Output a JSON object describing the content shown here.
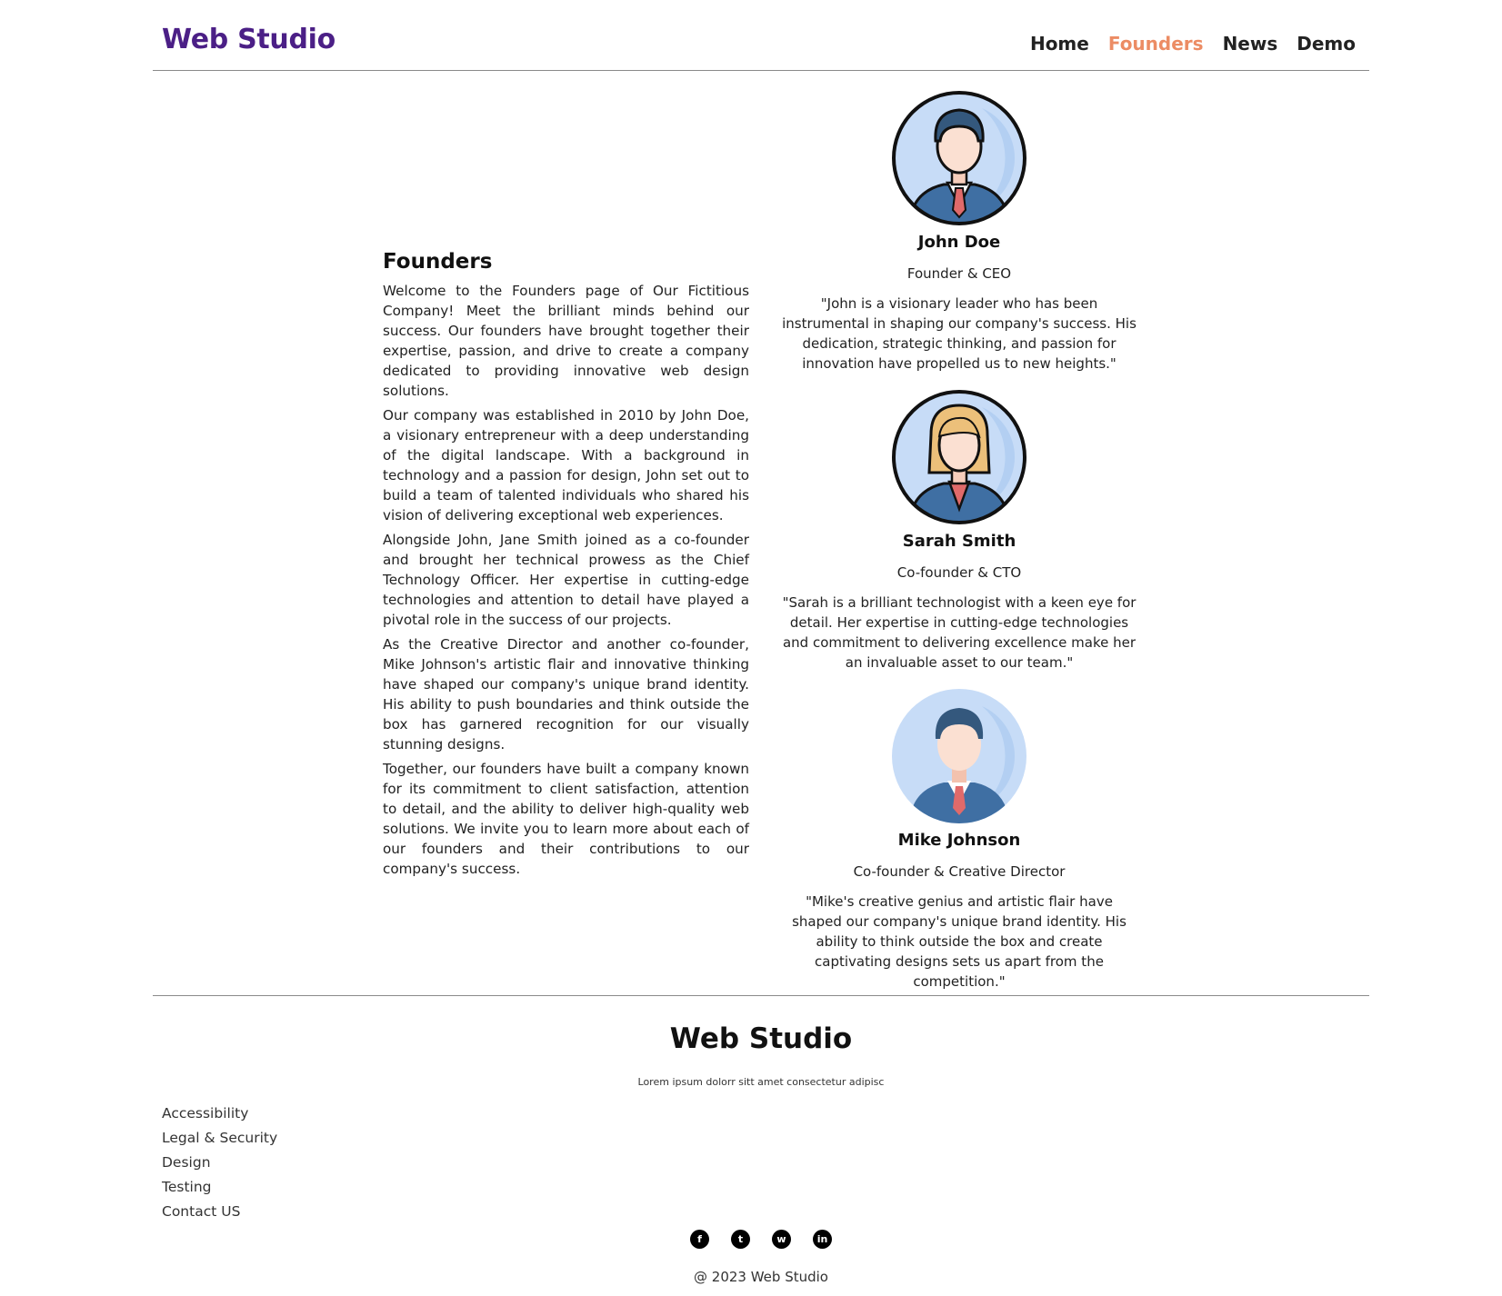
{
  "header": {
    "brand": "Web Studio",
    "nav": [
      {
        "label": "Home",
        "active": false
      },
      {
        "label": "Founders",
        "active": true
      },
      {
        "label": "News",
        "active": false
      },
      {
        "label": "Demo",
        "active": false
      }
    ]
  },
  "intro": {
    "title": "Founders",
    "paragraphs": [
      "Welcome to the Founders page of Our Fictitious Company! Meet the brilliant minds behind our success. Our founders have brought together their expertise, passion, and drive to create a company dedicated to providing innovative web design solutions.",
      "Our company was established in 2010 by John Doe, a visionary entrepreneur with a deep understanding of the digital landscape. With a background in technology and a passion for design, John set out to build a team of talented individuals who shared his vision of delivering exceptional web experiences.",
      "Alongside John, Jane Smith joined as a co-founder and brought her technical prowess as the Chief Technology Officer. Her expertise in cutting-edge technologies and attention to detail have played a pivotal role in the success of our projects.",
      "As the Creative Director and another co-founder, Mike Johnson's artistic flair and innovative thinking have shaped our company's unique brand identity. His ability to push boundaries and think outside the box has garnered recognition for our visually stunning designs.",
      "Together, our founders have built a company known for its commitment to client satisfaction, attention to detail, and the ability to deliver high-quality web solutions. We invite you to learn more about each of our founders and their contributions to our company's success."
    ]
  },
  "founders": [
    {
      "name": "John Doe",
      "role": "Founder & CEO",
      "quote": "\"John is a visionary leader who has been instrumental in shaping our company's success. His dedication, strategic thinking, and passion for innovation have propelled us to new heights.\"",
      "avatar": "businessman-avatar-icon"
    },
    {
      "name": "Sarah Smith",
      "role": "Co-founder & CTO",
      "quote": "\"Sarah is a brilliant technologist with a keen eye for detail. Her expertise in cutting-edge technologies and commitment to delivering excellence make her an invaluable asset to our team.\"",
      "avatar": "businesswoman-avatar-icon"
    },
    {
      "name": "Mike Johnson",
      "role": "Co-founder & Creative Director",
      "quote": "\"Mike's creative genius and artistic flair have shaped our company's unique brand identity. His ability to think outside the box and create captivating designs sets us apart from the competition.\"",
      "avatar": "businessman-flat-avatar-icon"
    }
  ],
  "footer": {
    "brand": "Web Studio",
    "tagline": "Lorem ipsum dolorr sitt amet consectetur adipisc",
    "links": [
      "Accessibility",
      "Legal & Security",
      "Design",
      "Testing",
      "Contact US"
    ],
    "social": [
      {
        "icon": "facebook-icon",
        "glyph": "f"
      },
      {
        "icon": "twitter-icon",
        "glyph": "t"
      },
      {
        "icon": "whatsapp-icon",
        "glyph": "w"
      },
      {
        "icon": "linkedin-icon",
        "glyph": "in"
      }
    ],
    "copyright": "@ 2023 Web Studio"
  },
  "colors": {
    "brand": "#4b1f86",
    "nav_active": "#ec8c64",
    "avatar_bg": "#c7dcf7",
    "suit": "#3f6fa3",
    "tie": "#e06a6a"
  }
}
